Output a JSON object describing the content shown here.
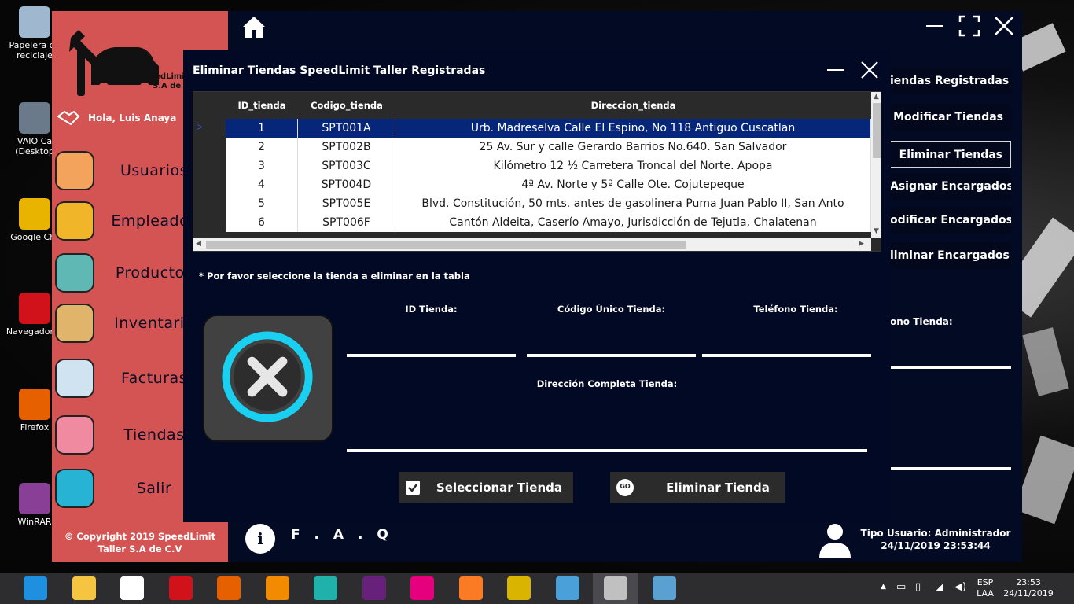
{
  "desktop": {
    "icons": [
      {
        "label": "Papelera de\nreciclaje",
        "name": "recycle-bin",
        "color": "#9fb8d0"
      },
      {
        "label": "VAIO Ca\n(Desktop",
        "name": "vaio-care",
        "color": "#6b7a8a"
      },
      {
        "label": "Google Chr",
        "name": "chrome",
        "color": "#e8b400"
      },
      {
        "label": "Navegador O",
        "name": "opera",
        "color": "#d1121a"
      },
      {
        "label": "Firefox",
        "name": "firefox",
        "color": "#e66000"
      },
      {
        "label": "WinRAR",
        "name": "winrar",
        "color": "#8a3f96"
      }
    ]
  },
  "app": {
    "logo_text_1": "SpeedLimit",
    "logo_text_2": "S.A de C",
    "greeting": "Hola, Luis Anaya",
    "nav": [
      {
        "label": "Usuarios",
        "icon": "user-avatar-icon"
      },
      {
        "label": "Empleados",
        "icon": "employee-badge-icon"
      },
      {
        "label": "Productos",
        "icon": "shopping-basket-icon"
      },
      {
        "label": "Inventario",
        "icon": "box-icon"
      },
      {
        "label": "Facturas",
        "icon": "invoice-icon"
      },
      {
        "label": "Tiendas",
        "icon": "store-icon"
      },
      {
        "label": "Salir",
        "icon": "exit-door-icon"
      }
    ],
    "copyright": "© Copyright 2019 SpeedLimit Taller S.A de C.V",
    "right_buttons": [
      "iendas Registradas",
      "Modificar Tiendas",
      "Eliminar Tiendas",
      "Asignar Encargados",
      "odificar Encargados",
      "liminar Encargados"
    ],
    "right_field_label": "ono Tienda:",
    "faq_icon": "i",
    "faq_label": "F . A . Q",
    "user_type": "Tipo Usuario: Administrador",
    "datetime": "24/11/2019 23:53:44"
  },
  "dialog": {
    "title": "Eliminar Tiendas SpeedLimit Taller Registradas",
    "columns": [
      "ID_tienda",
      "Codigo_tienda",
      "Direccion_tienda"
    ],
    "rows": [
      [
        "1",
        "SPT001A",
        "Urb. Madreselva Calle El Espino, No 118 Antiguo Cuscatlan"
      ],
      [
        "2",
        "SPT002B",
        "25 Av. Sur y calle Gerardo Barrios No.640. San Salvador"
      ],
      [
        "3",
        "SPT003C",
        "Kilómetro 12 ½ Carretera Troncal del Norte. Apopa"
      ],
      [
        "4",
        "SPT004D",
        "4ª Av. Norte y 5ª Calle Ote. Cojutepeque"
      ],
      [
        "5",
        "SPT005E",
        "Blvd. Constitución, 50 mts. antes de gasolinera Puma Juan Pablo II, San Anto"
      ],
      [
        "6",
        "SPT006F",
        "Cantón Aldeita, Caserío Amayo, Jurisdicción de Tejutla, Chalatenan"
      ]
    ],
    "selected_row": 0,
    "hint": "* Por favor seleccione la tienda a eliminar en la tabla",
    "fields": {
      "id_label": "ID Tienda:",
      "code_label": "Código Único Tienda:",
      "phone_label": "Teléfono Tienda:",
      "address_label": "Dirección Completa Tienda:"
    },
    "select_button": "Seleccionar Tienda",
    "delete_button": "Eliminar Tienda",
    "go_icon_text": "GO"
  },
  "taskbar": {
    "apps": [
      "ie",
      "file-explorer",
      "chrome",
      "opera",
      "firefox",
      "sublime-text",
      "cmder",
      "visual-studio",
      "wampserver",
      "xampp",
      "tools",
      "virtualbox",
      "connection",
      "paint"
    ],
    "lang_1": "ESP",
    "lang_2": "LAA",
    "time": "23:53",
    "date": "24/11/2019"
  },
  "colors": {
    "sidebar": "#d45454",
    "app_bg": "#030a24",
    "selected_row": "#06267a",
    "accent_cyan": "#1ad0f0"
  }
}
